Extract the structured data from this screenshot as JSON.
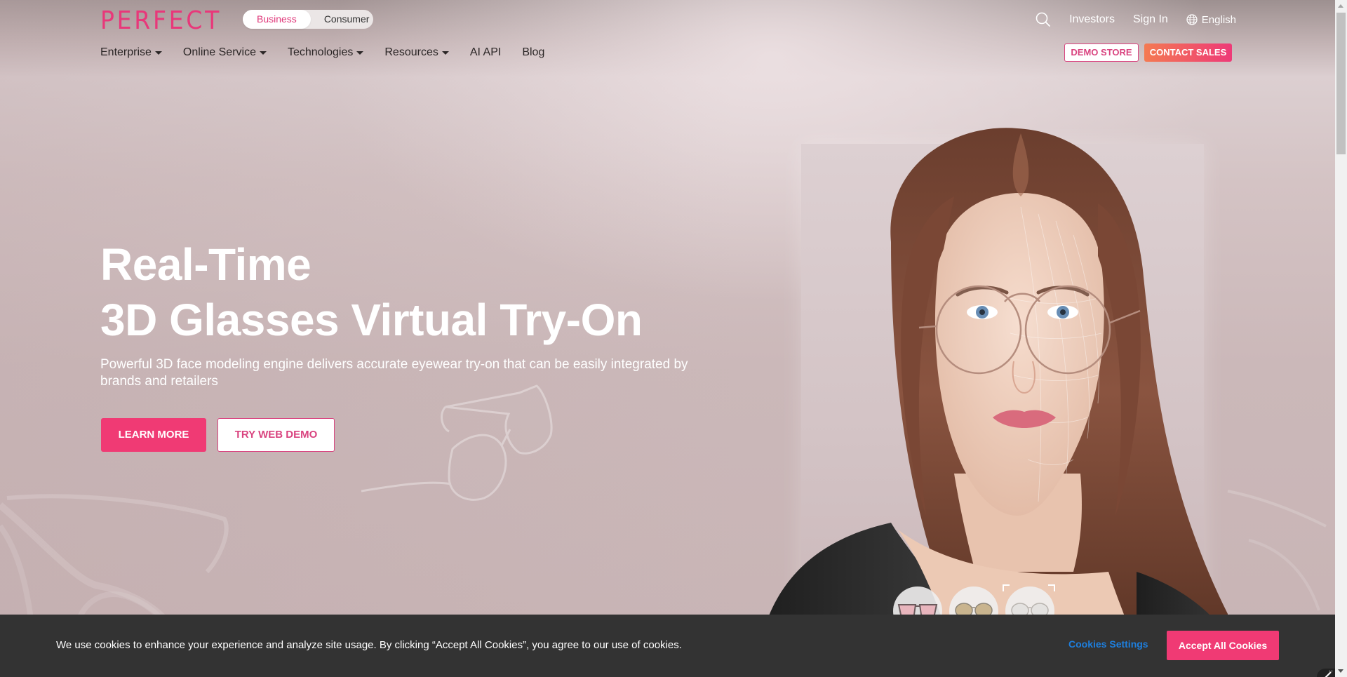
{
  "header": {
    "logo": "PERFECT",
    "audience_toggle": [
      {
        "label": "Business",
        "active": true
      },
      {
        "label": "Consumer",
        "active": false
      }
    ],
    "nav": [
      {
        "label": "Enterprise",
        "dropdown": true
      },
      {
        "label": "Online Service",
        "dropdown": true
      },
      {
        "label": "Technologies",
        "dropdown": true
      },
      {
        "label": "Resources",
        "dropdown": true
      },
      {
        "label": "AI API",
        "dropdown": false
      },
      {
        "label": "Blog",
        "dropdown": false
      }
    ],
    "utility": {
      "search_icon": "search-icon",
      "investors": "Investors",
      "sign_in": "Sign In",
      "language_icon": "globe-icon",
      "language": "English"
    },
    "demo_store": "DEMO STORE",
    "contact_sales": "CONTACT SALES"
  },
  "hero": {
    "title_line1": "Real-Time",
    "title_line2": "3D Glasses Virtual Try-On",
    "subtitle": "Powerful 3D face modeling engine delivers accurate eyewear try-on that can be easily integrated by brands and retailers",
    "learn_more": "LEARN MORE",
    "try_web_demo": "TRY WEB DEMO",
    "eyewear_thumbnails": [
      "pink-cat-eye-glasses",
      "gold-aviator-sunglasses",
      "clear-round-glasses"
    ],
    "selected_thumbnail": 3
  },
  "cookie_banner": {
    "text": "We use cookies to enhance your experience and analyze site usage. By clicking “Accept All Cookies”, you agree to our use of cookies.",
    "settings": "Cookies Settings",
    "accept": "Accept All Cookies"
  },
  "colors": {
    "brand_pink": "#f03a74",
    "logo_pink": "#e8387a",
    "link_blue": "#1e7fde",
    "cookie_bg": "#333333",
    "hero_bg": "#cbb8b9"
  }
}
